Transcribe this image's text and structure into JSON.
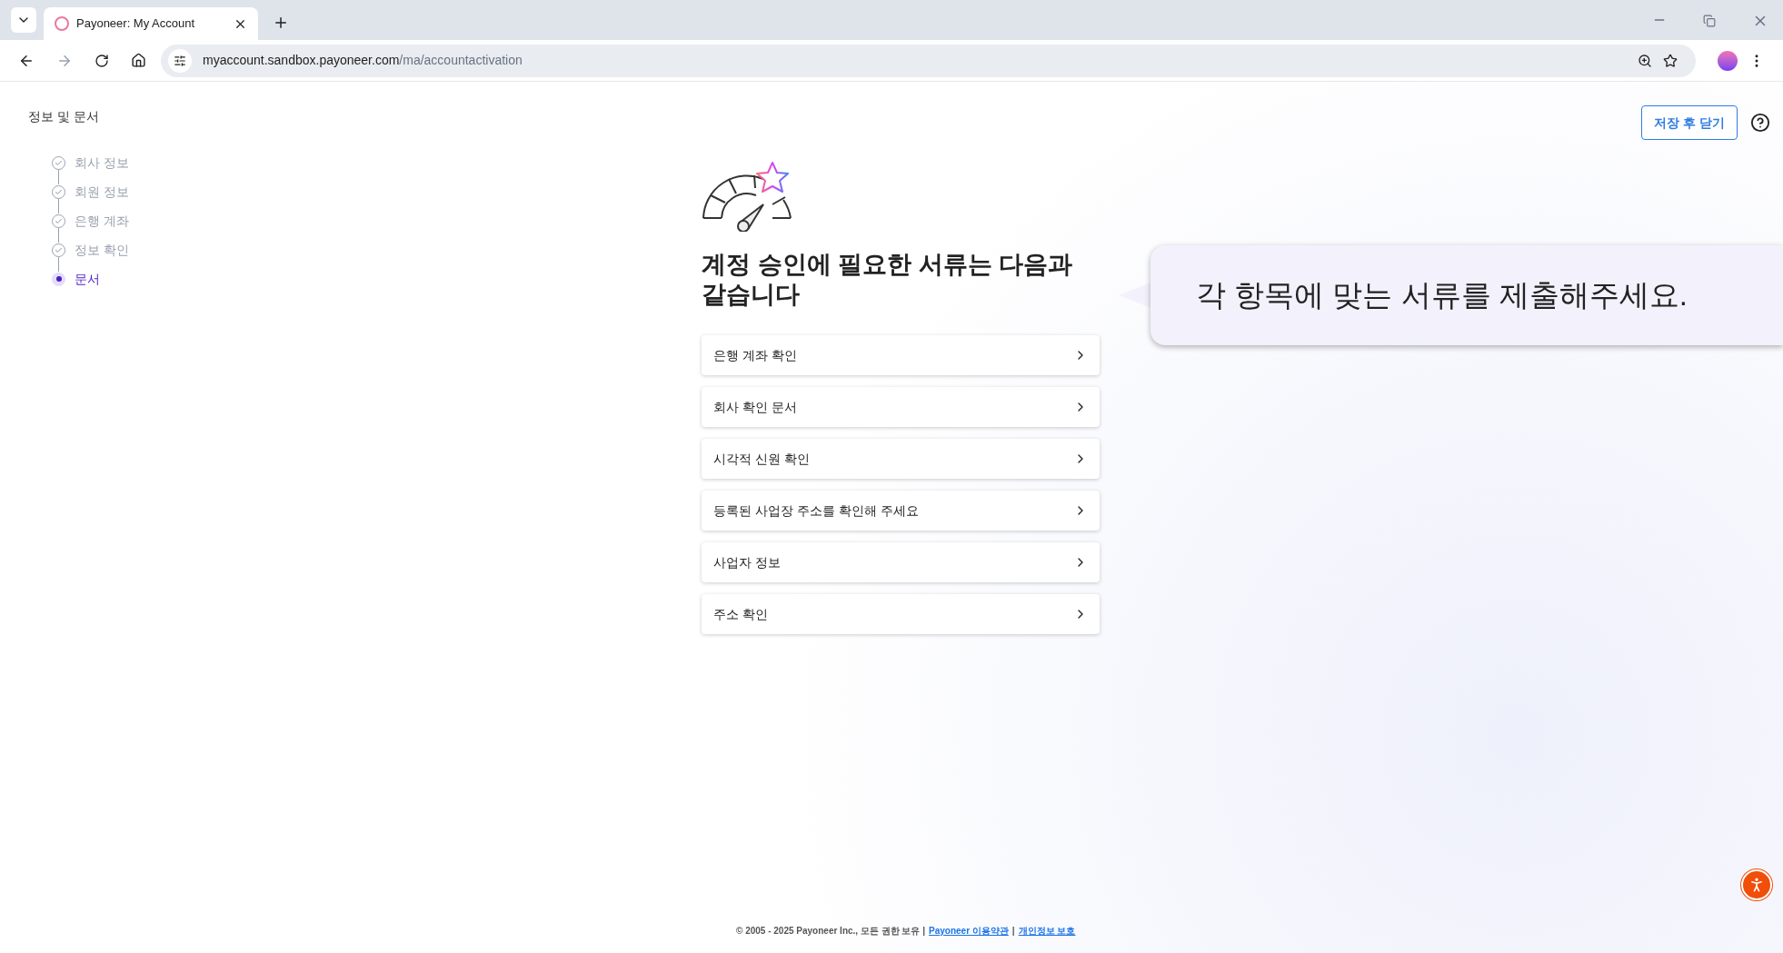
{
  "browser": {
    "tab_title": "Payoneer: My Account",
    "url_host": "myaccount.sandbox.payoneer.com",
    "url_path": "/ma/accountactivation"
  },
  "sidebar": {
    "title": "정보 및 문서",
    "steps": [
      {
        "label": "회사 정보",
        "done": true,
        "selected": false
      },
      {
        "label": "회원 정보",
        "done": true,
        "selected": false
      },
      {
        "label": "은행 계좌",
        "done": true,
        "selected": false
      },
      {
        "label": "정보 확인",
        "done": true,
        "selected": false
      },
      {
        "label": "문서",
        "done": false,
        "selected": true
      }
    ]
  },
  "header": {
    "save_button": "저장 후 닫기"
  },
  "main": {
    "heading": "계정 승인에 필요한 서류는 다음과 같습니다",
    "items": [
      "은행 계좌 확인",
      "회사 확인 문서",
      "시각적 신원 확인",
      "등록된 사업장 주소를 확인해 주세요",
      "사업자 정보",
      "주소 확인"
    ]
  },
  "callout": {
    "text": "각 항목에 맞는 서류를 제출해주세요."
  },
  "footer": {
    "copyright": "© 2005 - 2025 Payoneer Inc., 모든 권한 보유 |",
    "terms_link": "Payoneer 이용약관",
    "separator": "|",
    "privacy_link": "개인정보 보호"
  }
}
